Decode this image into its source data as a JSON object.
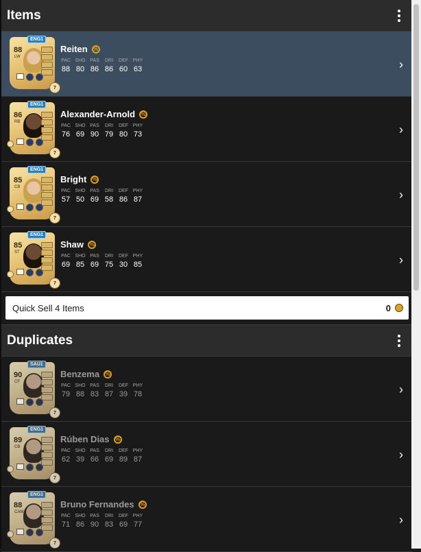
{
  "items_section": {
    "title": "Items",
    "players": [
      {
        "name": "Reiten",
        "rating": "88",
        "position": "LW",
        "league": "ENG1",
        "chem": "7",
        "stat_labels": [
          "PAC",
          "SHO",
          "PAS",
          "DRI",
          "DEF",
          "PHY"
        ],
        "stats": [
          "88",
          "80",
          "86",
          "86",
          "60",
          "63"
        ]
      },
      {
        "name": "Alexander-Arnold",
        "rating": "86",
        "position": "RB",
        "league": "ENG1",
        "chem": "7",
        "stat_labels": [
          "PAC",
          "SHO",
          "PAS",
          "DRI",
          "DEF",
          "PHY"
        ],
        "stats": [
          "76",
          "69",
          "90",
          "79",
          "80",
          "73"
        ]
      },
      {
        "name": "Bright",
        "rating": "85",
        "position": "CB",
        "league": "ENG1",
        "chem": "7",
        "stat_labels": [
          "PAC",
          "SHO",
          "PAS",
          "DRI",
          "DEF",
          "PHY"
        ],
        "stats": [
          "57",
          "50",
          "69",
          "58",
          "86",
          "87"
        ]
      },
      {
        "name": "Shaw",
        "rating": "85",
        "position": "ST",
        "league": "ENG1",
        "chem": "7",
        "stat_labels": [
          "PAC",
          "SHO",
          "PAS",
          "DRI",
          "DEF",
          "PHY"
        ],
        "stats": [
          "69",
          "85",
          "69",
          "75",
          "30",
          "85"
        ]
      }
    ],
    "quick_sell_label": "Quick Sell 4 Items",
    "quick_sell_value": "0"
  },
  "duplicates_section": {
    "title": "Duplicates",
    "players": [
      {
        "name": "Benzema",
        "rating": "90",
        "position": "CF",
        "league": "SAU1",
        "chem": "7",
        "stat_labels": [
          "PAC",
          "SHO",
          "PAS",
          "DRI",
          "DEF",
          "PHY"
        ],
        "stats": [
          "79",
          "88",
          "83",
          "87",
          "39",
          "78"
        ]
      },
      {
        "name": "Rúben Dias",
        "rating": "89",
        "position": "CB",
        "league": "ENG1",
        "chem": "7",
        "stat_labels": [
          "PAC",
          "SHO",
          "PAS",
          "DRI",
          "DEF",
          "PHY"
        ],
        "stats": [
          "62",
          "39",
          "66",
          "69",
          "89",
          "87"
        ]
      },
      {
        "name": "Bruno Fernandes",
        "rating": "88",
        "position": "CAM",
        "league": "ENG1",
        "chem": "7",
        "stat_labels": [
          "PAC",
          "SHO",
          "PAS",
          "DRI",
          "DEF",
          "PHY"
        ],
        "stats": [
          "71",
          "86",
          "90",
          "83",
          "69",
          "77"
        ]
      }
    ]
  },
  "icons": {
    "menu": "kebab-menu-icon",
    "chevron": "chevron-right-icon",
    "evolution": "evolution-icon",
    "coin": "coin-icon"
  },
  "colors": {
    "selected_row": "#3b4d5f",
    "card_gold": "#e8c679",
    "league_badge": "#2a7fbf",
    "evo_orange": "#e0a020"
  }
}
